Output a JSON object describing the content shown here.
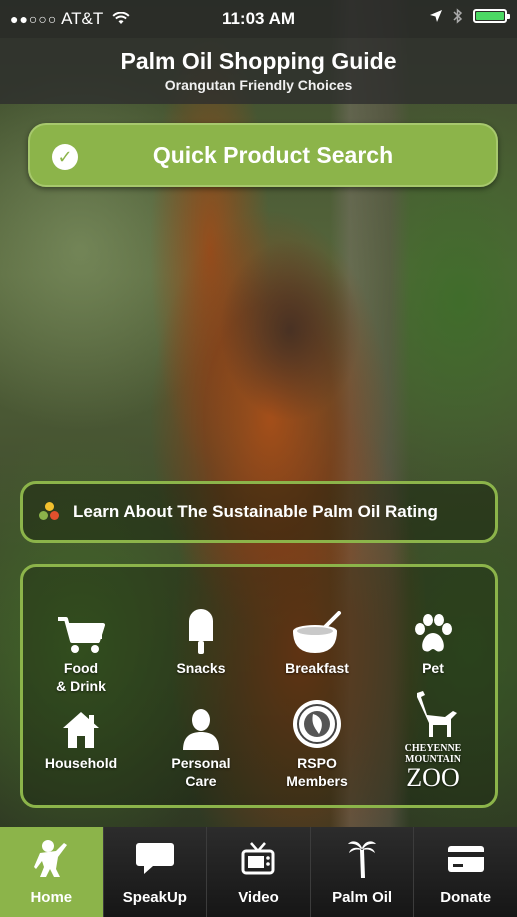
{
  "status_bar": {
    "carrier_dots": "●●○○○",
    "carrier": "AT&T",
    "time": "11:03 AM"
  },
  "header": {
    "title": "Palm Oil Shopping Guide",
    "subtitle": "Orangutan Friendly Choices"
  },
  "quick_search": {
    "label": "Quick Product Search",
    "icon": "check-circle-icon"
  },
  "rating": {
    "label": "Learn About The Sustainable Palm Oil Rating",
    "dot_colors": [
      "#f2c12e",
      "#8cb44a",
      "#e2502d"
    ]
  },
  "categories": [
    {
      "label_line1": "Food",
      "label_line2": "& Drink",
      "icon": "cart-icon"
    },
    {
      "label_line1": "Snacks",
      "label_line2": "",
      "icon": "popsicle-icon"
    },
    {
      "label_line1": "Breakfast",
      "label_line2": "",
      "icon": "bowl-icon"
    },
    {
      "label_line1": "Pet",
      "label_line2": "",
      "icon": "paw-icon"
    },
    {
      "label_line1": "Household",
      "label_line2": "",
      "icon": "house-icon"
    },
    {
      "label_line1": "Personal",
      "label_line2": "Care",
      "icon": "person-icon"
    },
    {
      "label_line1": "RSPO",
      "label_line2": "Members",
      "icon": "rspo-logo-icon"
    },
    {
      "label_line1": "CHEYENNE",
      "label_line2": "MOUNTAIN",
      "label_line3": "ZOO",
      "icon": "giraffe-logo-icon"
    }
  ],
  "tabs": [
    {
      "label": "Home",
      "icon": "orangutan-icon",
      "active": true
    },
    {
      "label": "SpeakUp",
      "icon": "speech-bubble-icon",
      "active": false
    },
    {
      "label": "Video",
      "icon": "tv-icon",
      "active": false
    },
    {
      "label": "Palm Oil",
      "icon": "palm-tree-icon",
      "active": false
    },
    {
      "label": "Donate",
      "icon": "credit-card-icon",
      "active": false
    }
  ],
  "colors": {
    "accent_green": "#8cb44a",
    "battery_green": "#4cd964"
  }
}
